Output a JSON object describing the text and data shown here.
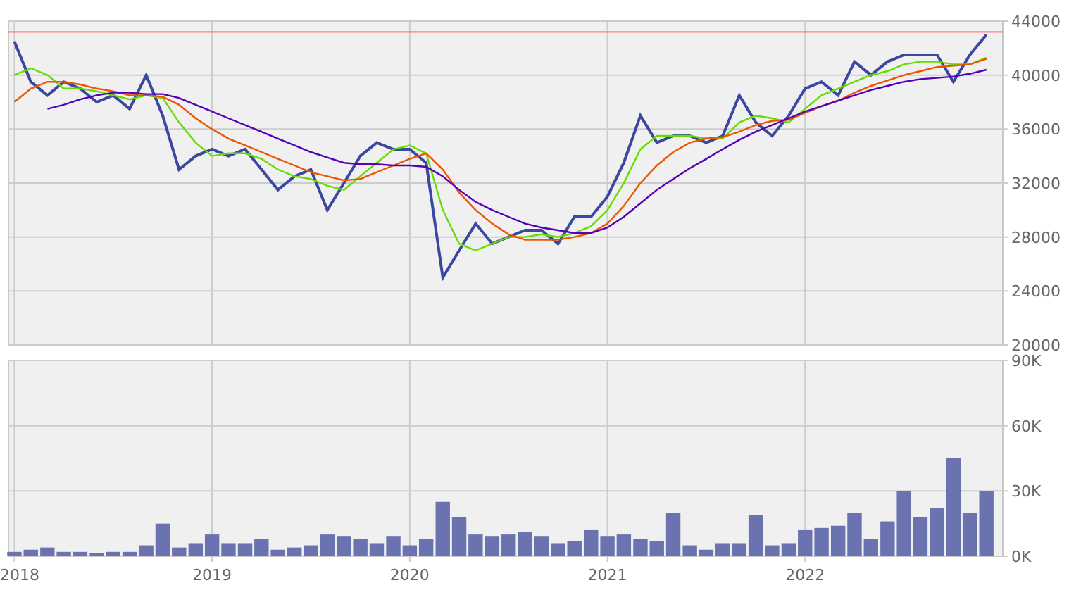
{
  "price_panel": {
    "chart_data": {
      "type": "line",
      "xlim": [
        2017.97,
        2023.0
      ],
      "ylim": [
        20000,
        44000
      ],
      "yticks": [
        {
          "value": 20000,
          "label": "20000"
        },
        {
          "value": 24000,
          "label": "24000"
        },
        {
          "value": 28000,
          "label": "28000"
        },
        {
          "value": 32000,
          "label": "32000"
        },
        {
          "value": 36000,
          "label": "36000"
        },
        {
          "value": 40000,
          "label": "40000"
        },
        {
          "value": 44000,
          "label": "44000"
        }
      ],
      "x": [
        2018.0,
        2018.083,
        2018.167,
        2018.25,
        2018.333,
        2018.417,
        2018.5,
        2018.583,
        2018.667,
        2018.75,
        2018.833,
        2018.917,
        2019.0,
        2019.083,
        2019.167,
        2019.25,
        2019.333,
        2019.417,
        2019.5,
        2019.583,
        2019.667,
        2019.75,
        2019.833,
        2019.917,
        2020.0,
        2020.083,
        2020.167,
        2020.25,
        2020.333,
        2020.417,
        2020.5,
        2020.583,
        2020.667,
        2020.75,
        2020.833,
        2020.917,
        2021.0,
        2021.083,
        2021.167,
        2021.25,
        2021.333,
        2021.417,
        2021.5,
        2021.583,
        2021.667,
        2021.75,
        2021.833,
        2021.917,
        2022.0,
        2022.083,
        2022.167,
        2022.25,
        2022.333,
        2022.417,
        2022.5,
        2022.583,
        2022.667,
        2022.75,
        2022.833,
        2022.917
      ],
      "series": [
        {
          "color": "#3c48a0",
          "values": [
            42500,
            39500,
            38500,
            39500,
            39000,
            38000,
            38500,
            37500,
            40000,
            37000,
            33000,
            34000,
            34500,
            34000,
            34500,
            33000,
            31500,
            32500,
            33000,
            30000,
            32000,
            34000,
            35000,
            34500,
            34500,
            33500,
            25000,
            27000,
            29000,
            27500,
            28000,
            28500,
            28500,
            27500,
            29500,
            29500,
            31000,
            33500,
            37000,
            35000,
            35500,
            35500,
            35000,
            35500,
            38500,
            36500,
            35500,
            37000,
            39000,
            39500,
            38500,
            41000,
            40000,
            41000,
            41500,
            41500,
            41500,
            39500,
            41500,
            43000
          ]
        },
        {
          "color": "#66dd00",
          "values": [
            40000,
            40500,
            40000,
            39000,
            39000,
            38800,
            38500,
            38200,
            38500,
            38300,
            36500,
            35000,
            34000,
            34200,
            34200,
            33800,
            33000,
            32500,
            32300,
            31800,
            31500,
            32500,
            33500,
            34500,
            34800,
            34200,
            30000,
            27500,
            27000,
            27500,
            28000,
            28000,
            28200,
            28000,
            28300,
            28800,
            30000,
            32000,
            34500,
            35500,
            35500,
            35500,
            35300,
            35300,
            36500,
            37000,
            36800,
            36500,
            37500,
            38500,
            39000,
            39500,
            40000,
            40300,
            40800,
            41000,
            41000,
            40800,
            40800,
            41300
          ]
        },
        {
          "color": "#ee5500",
          "values": [
            38000,
            39000,
            39500,
            39500,
            39300,
            39000,
            38800,
            38500,
            38500,
            38400,
            37800,
            36800,
            36000,
            35300,
            34800,
            34300,
            33800,
            33300,
            32800,
            32500,
            32200,
            32300,
            32800,
            33300,
            33800,
            34200,
            33000,
            31300,
            30000,
            29000,
            28200,
            27800,
            27800,
            27800,
            28000,
            28300,
            29000,
            30300,
            32000,
            33300,
            34300,
            35000,
            35300,
            35400,
            35800,
            36300,
            36600,
            36700,
            37200,
            37700,
            38100,
            38700,
            39200,
            39600,
            40000,
            40300,
            40600,
            40700,
            40800,
            41200
          ]
        },
        {
          "color": "#5500bb",
          "values": [
            null,
            null,
            37500,
            37800,
            38200,
            38500,
            38700,
            38700,
            38600,
            38600,
            38300,
            37800,
            37300,
            36800,
            36300,
            35800,
            35300,
            34800,
            34300,
            33900,
            33500,
            33400,
            33400,
            33300,
            33300,
            33200,
            32500,
            31500,
            30600,
            30000,
            29500,
            29000,
            28700,
            28500,
            28300,
            28300,
            28700,
            29500,
            30500,
            31500,
            32300,
            33100,
            33800,
            34500,
            35200,
            35800,
            36300,
            36800,
            37300,
            37700,
            38100,
            38500,
            38900,
            39200,
            39500,
            39700,
            39800,
            39900,
            40100,
            40400
          ]
        }
      ],
      "ref_lines": [
        {
          "axis": "y",
          "value": 43200,
          "color": "#ff8080"
        }
      ],
      "grid": true
    }
  },
  "volume_panel": {
    "chart_data": {
      "type": "bar",
      "grid": true,
      "xlim": [
        2017.97,
        2023.0
      ],
      "ylim": [
        0,
        90000
      ],
      "xticks": [
        {
          "value": 2018,
          "label": "2018"
        },
        {
          "value": 2019,
          "label": "2019"
        },
        {
          "value": 2020,
          "label": "2020"
        },
        {
          "value": 2021,
          "label": "2021"
        },
        {
          "value": 2022,
          "label": "2022"
        }
      ],
      "yticks": [
        {
          "value": 0,
          "label": "0K"
        },
        {
          "value": 30000,
          "label": "30K"
        },
        {
          "value": 60000,
          "label": "60K"
        },
        {
          "value": 90000,
          "label": "90K"
        }
      ],
      "x": [
        2018.0,
        2018.083,
        2018.167,
        2018.25,
        2018.333,
        2018.417,
        2018.5,
        2018.583,
        2018.667,
        2018.75,
        2018.833,
        2018.917,
        2019.0,
        2019.083,
        2019.167,
        2019.25,
        2019.333,
        2019.417,
        2019.5,
        2019.583,
        2019.667,
        2019.75,
        2019.833,
        2019.917,
        2020.0,
        2020.083,
        2020.167,
        2020.25,
        2020.333,
        2020.417,
        2020.5,
        2020.583,
        2020.667,
        2020.75,
        2020.833,
        2020.917,
        2021.0,
        2021.083,
        2021.167,
        2021.25,
        2021.333,
        2021.417,
        2021.5,
        2021.583,
        2021.667,
        2021.75,
        2021.833,
        2021.917,
        2022.0,
        2022.083,
        2022.167,
        2022.25,
        2022.333,
        2022.417,
        2022.5,
        2022.583,
        2022.667,
        2022.75,
        2022.833,
        2022.917
      ],
      "series": [
        {
          "color": "#6b72b0",
          "values": [
            2000,
            3000,
            4000,
            2000,
            2000,
            1500,
            2000,
            2000,
            5000,
            15000,
            4000,
            6000,
            10000,
            6000,
            6000,
            8000,
            3000,
            4000,
            5000,
            10000,
            9000,
            8000,
            6000,
            9000,
            5000,
            8000,
            25000,
            18000,
            10000,
            9000,
            10000,
            11000,
            9000,
            6000,
            7000,
            12000,
            9000,
            10000,
            8000,
            7000,
            20000,
            5000,
            3000,
            6000,
            6000,
            19000,
            5000,
            6000,
            12000,
            13000,
            14000,
            20000,
            8000,
            16000,
            30000,
            18000,
            22000,
            45000,
            20000,
            30000
          ]
        }
      ]
    }
  }
}
